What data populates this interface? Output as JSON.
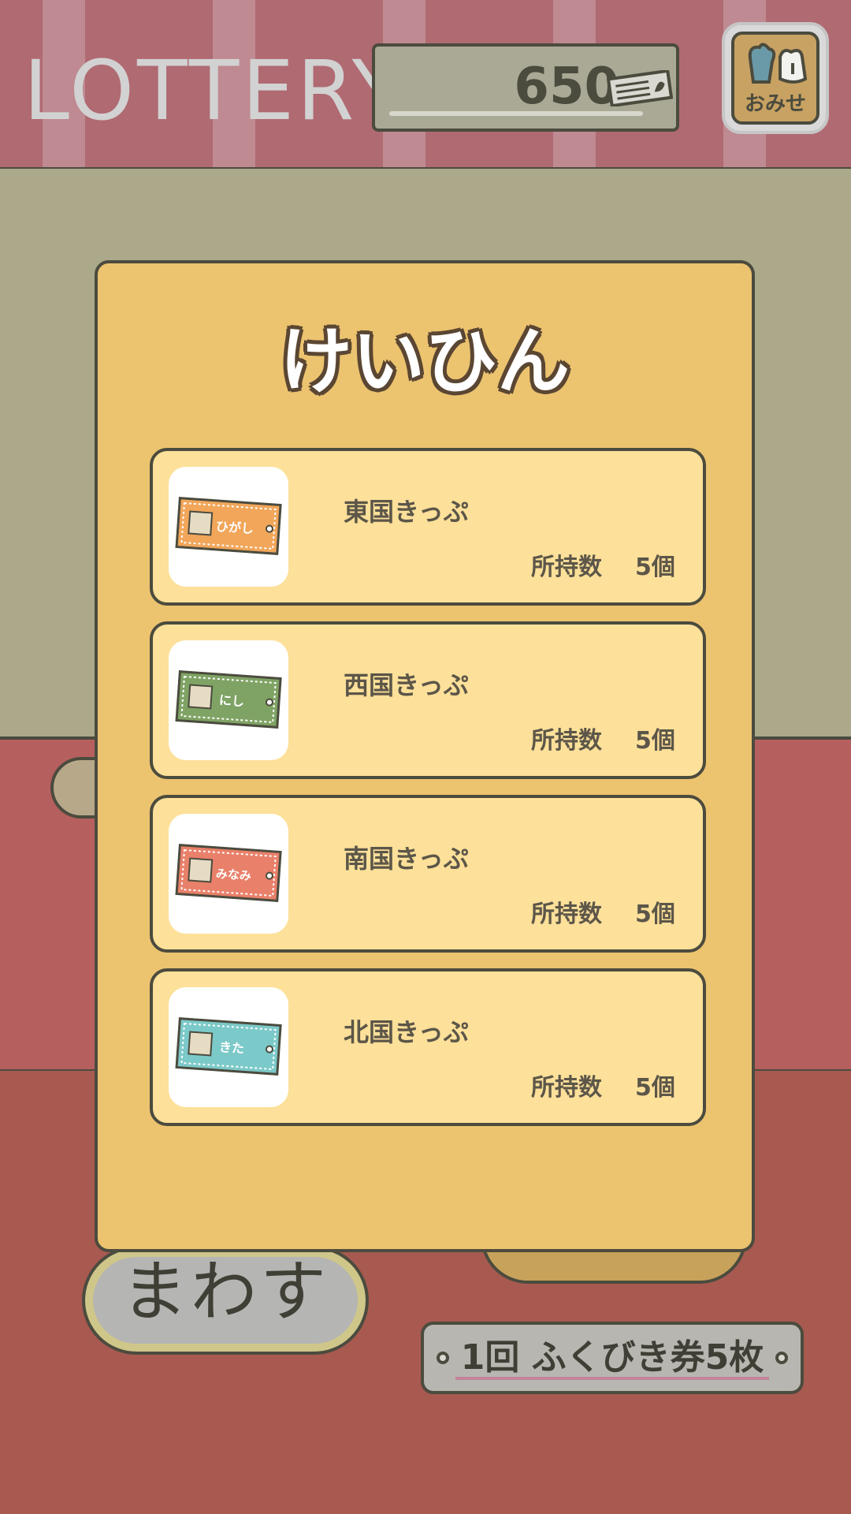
{
  "header": {
    "title": "LOTTERY",
    "ticket_count": "650",
    "ticket_icon": "lottery-ticket-icon",
    "shop_label": "おみせ",
    "shop_icon": "shopping-bags-icon"
  },
  "dialog": {
    "title": "けいひん",
    "prizes": [
      {
        "name": "東国きっぷ",
        "ticket_text": "ひがし",
        "count_label": "所持数",
        "count": "5個",
        "color": "#f1a65a"
      },
      {
        "name": "西国きっぷ",
        "ticket_text": "にし",
        "count_label": "所持数",
        "count": "5個",
        "color": "#7fa364"
      },
      {
        "name": "南国きっぷ",
        "ticket_text": "みなみ",
        "count_label": "所持数",
        "count": "5個",
        "color": "#e9806a"
      },
      {
        "name": "北国きっぷ",
        "ticket_text": "きた",
        "count_label": "所持数",
        "count": "5個",
        "color": "#7cc9c9"
      }
    ]
  },
  "controls": {
    "spin_label": "まわす",
    "cost_label": "1回 ふくびき券5枚"
  },
  "colors": {
    "dialog_bg": "#ecc36f",
    "card_bg": "#fde099",
    "outline": "#4b4b3e",
    "wall": "#aba98a",
    "floor": "#a85a50"
  }
}
